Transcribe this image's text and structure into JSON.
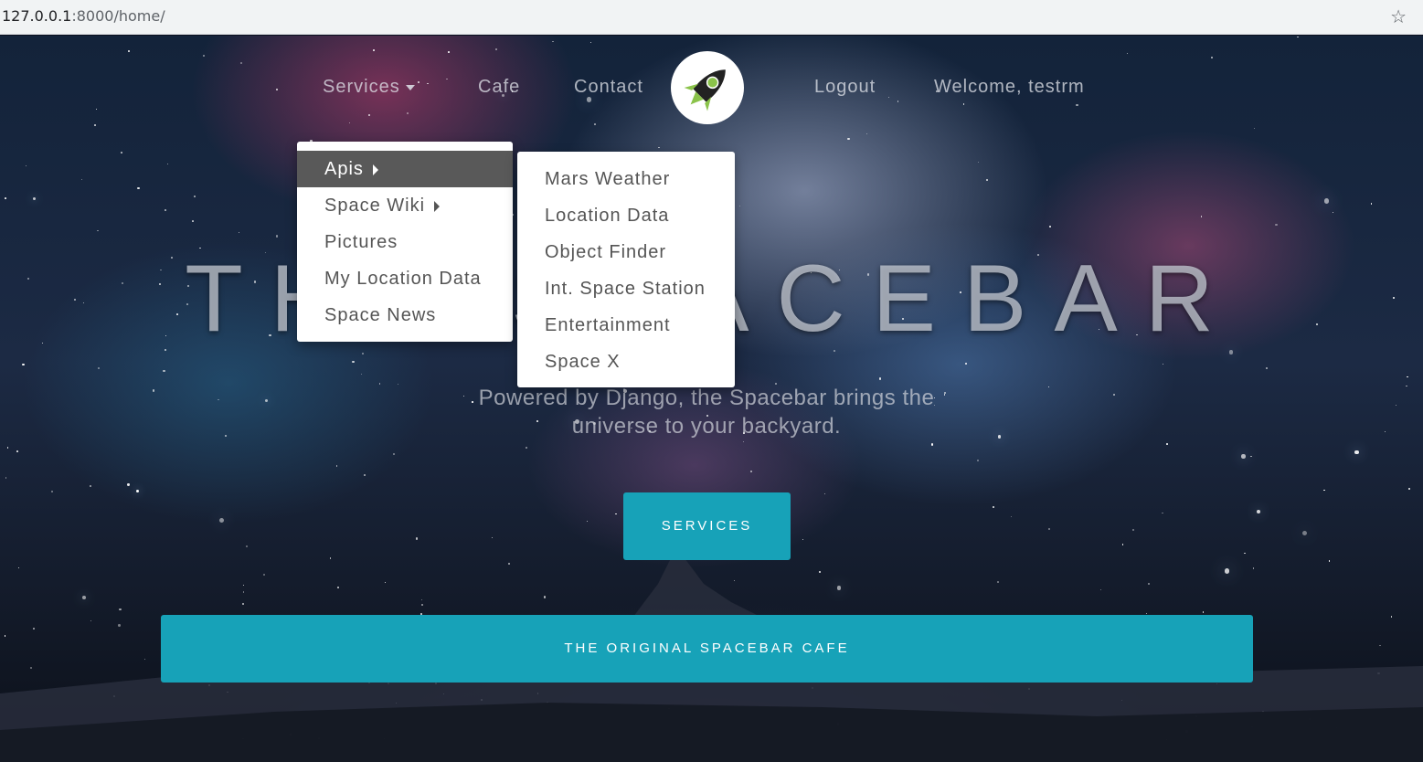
{
  "browser": {
    "url_host": "127.0.0.1",
    "url_rest": ":8000/home/",
    "bookmark_icon": "star-icon"
  },
  "nav": {
    "services": "Services",
    "cafe": "Cafe",
    "contact": "Contact",
    "logo_icon": "rocket-icon",
    "logout": "Logout",
    "welcome": "Welcome, testrm"
  },
  "services_menu": {
    "items": [
      {
        "label": "Apis",
        "has_submenu": true,
        "active": true
      },
      {
        "label": "Space Wiki",
        "has_submenu": true,
        "active": false
      },
      {
        "label": "Pictures",
        "has_submenu": false,
        "active": false
      },
      {
        "label": "My Location Data",
        "has_submenu": false,
        "active": false
      },
      {
        "label": "Space News",
        "has_submenu": false,
        "active": false
      }
    ]
  },
  "apis_submenu": {
    "items": [
      {
        "label": "Mars Weather"
      },
      {
        "label": "Location Data"
      },
      {
        "label": "Object Finder"
      },
      {
        "label": "Int. Space Station"
      },
      {
        "label": "Entertainment"
      },
      {
        "label": "Space X"
      }
    ]
  },
  "hero": {
    "title": "THE SPACEBAR",
    "subtitle": "Powered by Django, the Spacebar brings the universe to your backyard.",
    "services_button": "SERVICES",
    "cafe_button": "THE ORIGINAL SPACEBAR CAFE"
  },
  "colors": {
    "accent": "#17a2b8",
    "menu_active_bg": "#595959"
  }
}
